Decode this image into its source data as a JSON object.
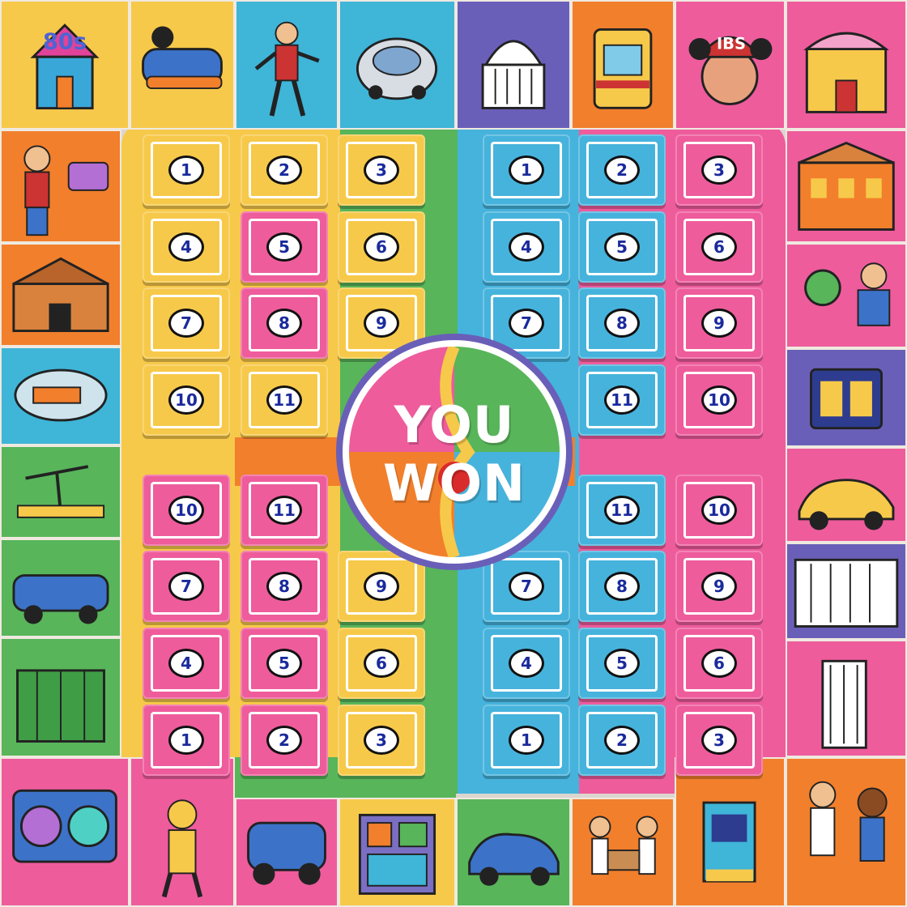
{
  "game": {
    "result_line1": "YOU",
    "result_line2": "WON",
    "colors": {
      "yellow": "#f7c94a",
      "pink": "#ee5c9c",
      "blue": "#46b3dc",
      "green": "#58b55a",
      "orange": "#f27f2c",
      "purple": "#6a5fb8"
    }
  },
  "border_decor": [
    {
      "name": "80s-house-icon",
      "label": "80s"
    },
    {
      "name": "sneaker-icon"
    },
    {
      "name": "dancer-icon"
    },
    {
      "name": "robot-vacuum-icon"
    },
    {
      "name": "capitol-building-icon"
    },
    {
      "name": "arcade-cabinet-icon"
    },
    {
      "name": "cap-woman-icon",
      "label": "IBS"
    },
    {
      "name": "theater-building-icon"
    },
    {
      "name": "ruffled-man-icon"
    },
    {
      "name": "boombox-icon"
    },
    {
      "name": "city-hall-icon"
    },
    {
      "name": "retro-car-icon"
    },
    {
      "name": "stage-set-icon"
    },
    {
      "name": "pedal-car-icon"
    },
    {
      "name": "tower-building-icon"
    },
    {
      "name": "stereo-speakers-icon"
    },
    {
      "name": "clown-icon"
    },
    {
      "name": "buggy-icon"
    },
    {
      "name": "stacked-crates-icon"
    },
    {
      "name": "blue-sports-car-icon"
    },
    {
      "name": "dancing-couple-icon"
    },
    {
      "name": "jukebox-icon"
    },
    {
      "name": "astronaut-kids-icon"
    },
    {
      "name": "old-building-icon"
    },
    {
      "name": "cartoon-friends-icon"
    },
    {
      "name": "scoreboard-icon"
    },
    {
      "name": "yellow-sports-car-icon"
    },
    {
      "name": "columned-building-icon"
    },
    {
      "name": "skyscraper-icon"
    }
  ],
  "quadrants": {
    "top_left": [
      {
        "label": "1",
        "color": "yellow"
      },
      {
        "label": "2",
        "color": "yellow"
      },
      {
        "label": "3",
        "color": "yellow"
      },
      {
        "label": "4",
        "color": "yellow"
      },
      {
        "label": "5",
        "color": "pink"
      },
      {
        "label": "6",
        "color": "yellow"
      },
      {
        "label": "7",
        "color": "yellow"
      },
      {
        "label": "8",
        "color": "pink"
      },
      {
        "label": "9",
        "color": "yellow"
      },
      {
        "label": "10",
        "color": "yellow"
      },
      {
        "label": "11",
        "color": "yellow"
      }
    ],
    "top_right": [
      {
        "label": "1",
        "color": "blue"
      },
      {
        "label": "2",
        "color": "blue"
      },
      {
        "label": "3",
        "color": "pink"
      },
      {
        "label": "4",
        "color": "blue"
      },
      {
        "label": "5",
        "color": "blue"
      },
      {
        "label": "6",
        "color": "pink"
      },
      {
        "label": "7",
        "color": "blue"
      },
      {
        "label": "8",
        "color": "blue"
      },
      {
        "label": "9",
        "color": "pink"
      },
      {
        "label": "11",
        "color": "blue"
      },
      {
        "label": "10",
        "color": "pink"
      }
    ],
    "bottom_left": [
      {
        "label": "10",
        "color": "pink"
      },
      {
        "label": "11",
        "color": "pink"
      },
      {
        "label": "7",
        "color": "pink"
      },
      {
        "label": "8",
        "color": "pink"
      },
      {
        "label": "9",
        "color": "yellow"
      },
      {
        "label": "4",
        "color": "pink"
      },
      {
        "label": "5",
        "color": "pink"
      },
      {
        "label": "6",
        "color": "yellow"
      },
      {
        "label": "1",
        "color": "pink"
      },
      {
        "label": "2",
        "color": "pink"
      },
      {
        "label": "3",
        "color": "yellow"
      }
    ],
    "bottom_right": [
      {
        "label": "11",
        "color": "blue"
      },
      {
        "label": "10",
        "color": "pink"
      },
      {
        "label": "7",
        "color": "blue"
      },
      {
        "label": "8",
        "color": "blue"
      },
      {
        "label": "9",
        "color": "pink"
      },
      {
        "label": "4",
        "color": "blue"
      },
      {
        "label": "5",
        "color": "blue"
      },
      {
        "label": "6",
        "color": "pink"
      },
      {
        "label": "1",
        "color": "blue"
      },
      {
        "label": "2",
        "color": "blue"
      },
      {
        "label": "3",
        "color": "pink"
      }
    ]
  }
}
